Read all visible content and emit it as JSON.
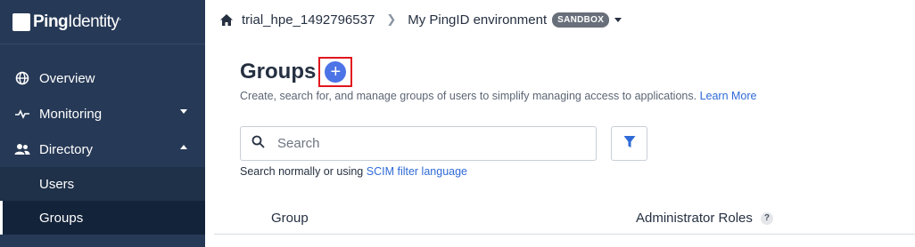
{
  "app": {
    "logo_bold": "Ping",
    "logo_thin": "Identity",
    "logo_reg": "."
  },
  "sidebar": {
    "items": [
      {
        "label": "Overview",
        "icon": "globe-icon"
      },
      {
        "label": "Monitoring",
        "icon": "pulse-icon",
        "expanded": false
      },
      {
        "label": "Directory",
        "icon": "users-icon",
        "expanded": true
      }
    ],
    "sub_items": [
      {
        "label": "Users",
        "active": false
      },
      {
        "label": "Groups",
        "active": true
      }
    ]
  },
  "topbar": {
    "org": "trial_hpe_1492796537",
    "environment": "My PingID environment",
    "badge": "SANDBOX"
  },
  "page": {
    "title": "Groups",
    "add_symbol": "+",
    "subtitle": "Create, search for, and manage groups of users to simplify managing access to applications.",
    "learn_more": "Learn More",
    "search_placeholder": "Search",
    "hint_prefix": "Search normally or using",
    "hint_link": "SCIM filter language"
  },
  "table": {
    "columns": [
      "Group",
      "Administrator Roles"
    ],
    "help_symbol": "?"
  },
  "colors": {
    "sidebar_bg": "#263956",
    "accent": "#4d74e6",
    "highlight_border": "#e0161d",
    "link": "#2f6ad6"
  }
}
